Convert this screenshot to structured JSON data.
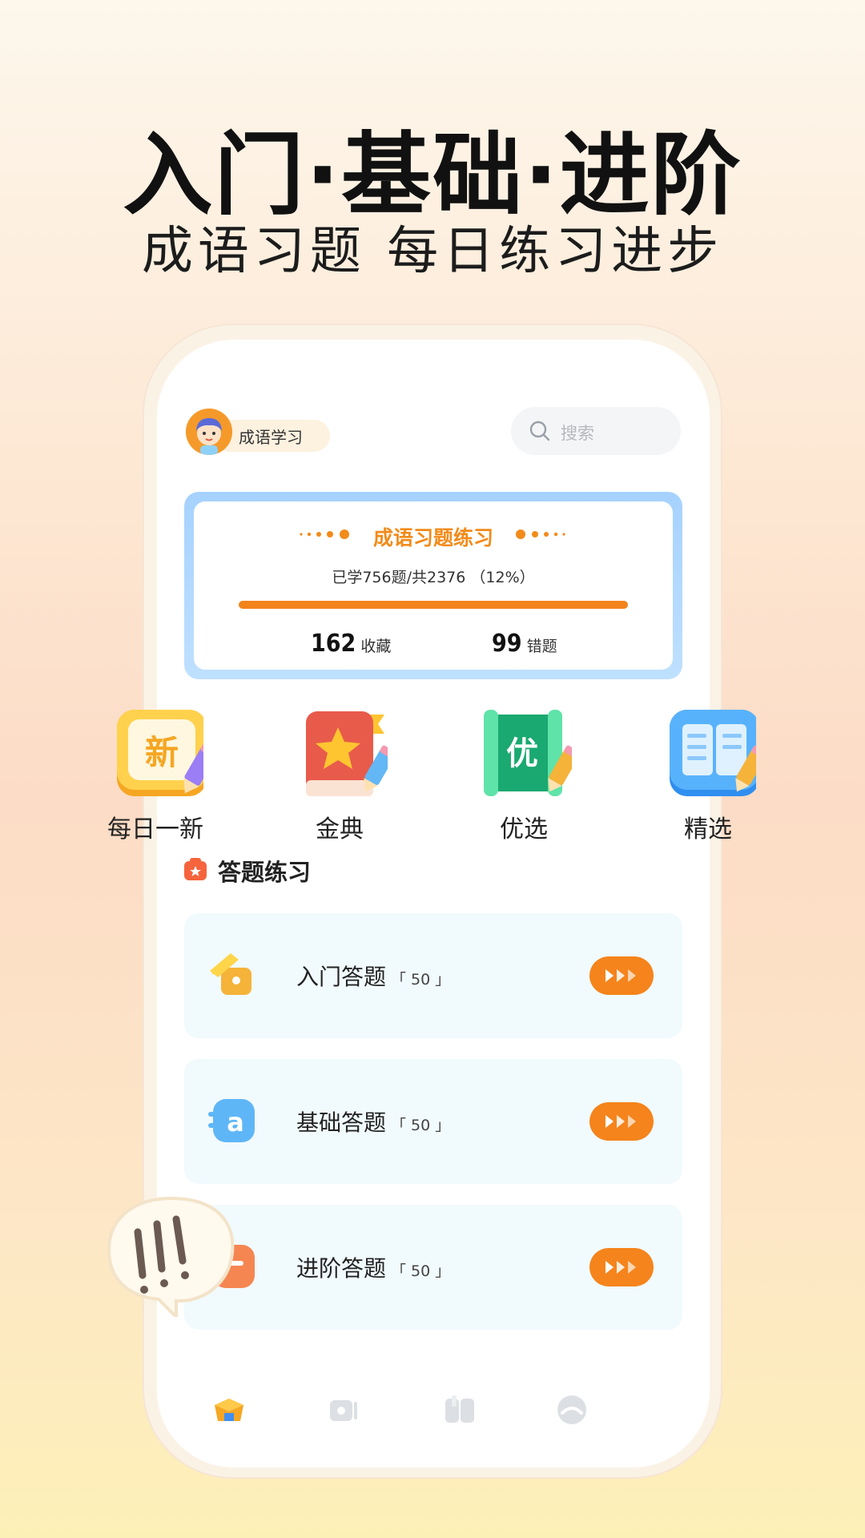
{
  "promo": {
    "headline": "入门·基础·进阶",
    "subline": "成语习题  每日练习进步"
  },
  "header": {
    "app_name": "成语学习",
    "search_placeholder": "搜索"
  },
  "progress_card": {
    "title": "成语习题练习",
    "progress_text": "已学756题/共2376 （12%）",
    "learned": 756,
    "total": 2376,
    "progress_percent": 12,
    "favorites_count": "162",
    "favorites_label": "收藏",
    "wrong_count": "99",
    "wrong_label": "错题"
  },
  "categories": [
    {
      "label": "每日一新",
      "icon": "new-badge-icon",
      "glyph": "新"
    },
    {
      "label": "金典",
      "icon": "star-book-icon"
    },
    {
      "label": "优选",
      "icon": "scroll-icon",
      "glyph": "优"
    },
    {
      "label": "精选",
      "icon": "open-book-icon"
    }
  ],
  "section": {
    "title": "答题练习"
  },
  "quizzes": [
    {
      "label": "入门答题",
      "count": "「 50 」",
      "icon": "house-icon",
      "color": "#f5b33a"
    },
    {
      "label": "基础答题",
      "count": "「 50 」",
      "icon": "letter-a-icon",
      "color": "#5fb6f7"
    },
    {
      "label": "进阶答题",
      "count": "「 50 」",
      "icon": "advanced-icon",
      "color": "#f58651"
    }
  ],
  "bottom_nav": [
    {
      "icon": "home-icon",
      "active": true
    },
    {
      "icon": "video-icon",
      "active": false
    },
    {
      "icon": "book-icon",
      "active": false
    },
    {
      "icon": "profile-icon",
      "active": false
    }
  ],
  "colors": {
    "accent": "#f3831b",
    "card_border": "#a6d2ff",
    "quiz_bg": "#f1fafd"
  }
}
